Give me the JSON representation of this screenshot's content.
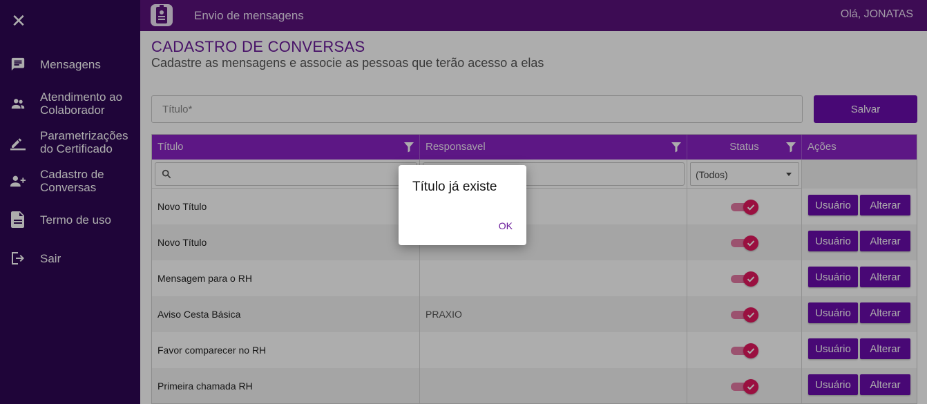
{
  "header": {
    "app_title": "Envio de mensagens",
    "greeting": "Olá, JONATAS"
  },
  "sidebar": {
    "close_icon": "close-icon",
    "items": [
      {
        "label": "Mensagens",
        "icon": "chat-icon"
      },
      {
        "label": "Atendimento ao Colaborador",
        "icon": "group-icon"
      },
      {
        "label": "Parametrizações do Certificado",
        "icon": "pencil-icon"
      },
      {
        "label": "Cadastro de Conversas",
        "icon": "add-user-icon"
      },
      {
        "label": "Termo de uso",
        "icon": "document-icon"
      },
      {
        "label": "Sair",
        "icon": "logout-icon"
      }
    ]
  },
  "page": {
    "title": "CADASTRO DE CONVERSAS",
    "subtitle": "Cadastre as mensagens e associe as pessoas que terão acesso a elas",
    "title_placeholder": "Título*",
    "save_label": "Salvar"
  },
  "table": {
    "columns": [
      "Título",
      "Responsavel",
      "Status",
      "Ações"
    ],
    "status_filter": "(Todos)",
    "user_button": "Usuário",
    "edit_button": "Alterar",
    "rows": [
      {
        "titulo": "Novo Título",
        "responsavel": "",
        "status": true
      },
      {
        "titulo": "Novo Título",
        "responsavel": "",
        "status": true
      },
      {
        "titulo": "Mensagem para o RH",
        "responsavel": "",
        "status": true
      },
      {
        "titulo": "Aviso Cesta Básica",
        "responsavel": "PRAXIO",
        "status": true
      },
      {
        "titulo": "Favor comparecer no RH",
        "responsavel": "",
        "status": true
      },
      {
        "titulo": "Primeira chamada RH",
        "responsavel": "",
        "status": true
      }
    ]
  },
  "dialog": {
    "message": "Título já existe",
    "ok_label": "OK"
  },
  "colors": {
    "sidebar": "#2e0854",
    "header": "#5a127c",
    "table_header": "#8a22c4",
    "accent": "#6a0dad",
    "toggle": "#e3185f"
  }
}
